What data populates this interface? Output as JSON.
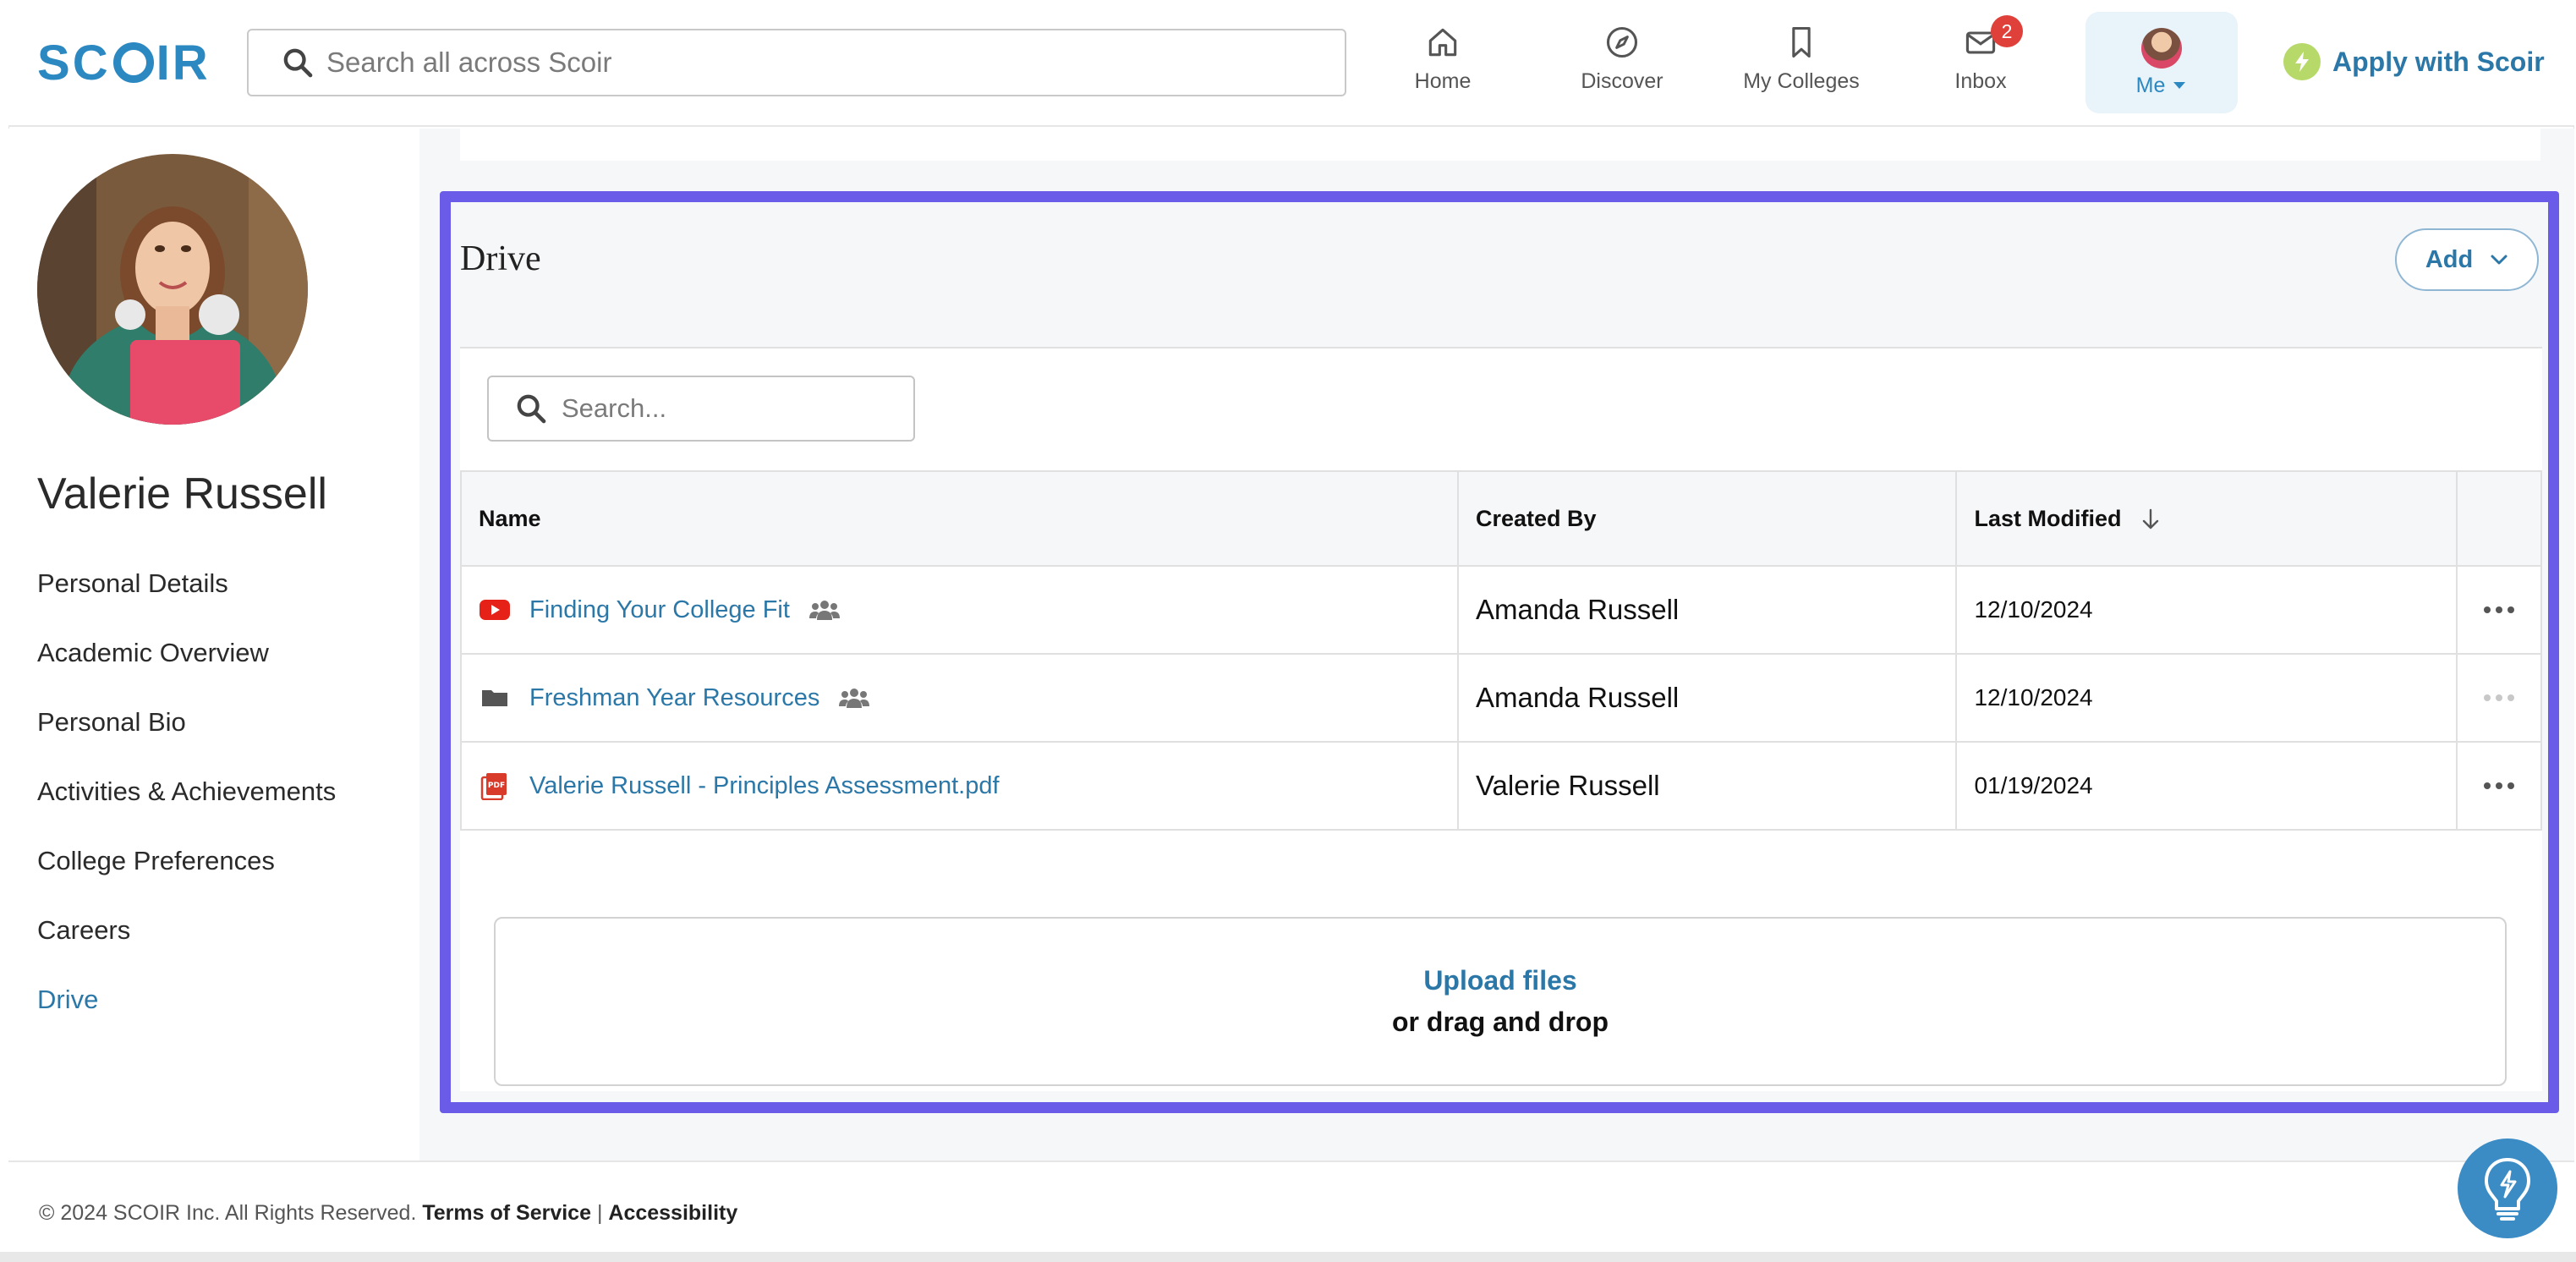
{
  "header": {
    "logo": "SCOIR",
    "search_placeholder": "Search all across Scoir",
    "nav": [
      {
        "label": "Home",
        "icon": "home-icon"
      },
      {
        "label": "Discover",
        "icon": "compass-icon"
      },
      {
        "label": "My Colleges",
        "icon": "bookmark-icon"
      },
      {
        "label": "Inbox",
        "icon": "inbox-icon",
        "badge": "2"
      }
    ],
    "me_label": "Me",
    "apply_label": "Apply with Scoir"
  },
  "sidebar": {
    "name": "Valerie Russell",
    "links": [
      {
        "label": "Personal Details"
      },
      {
        "label": "Academic Overview"
      },
      {
        "label": "Personal Bio"
      },
      {
        "label": "Activities & Achievements"
      },
      {
        "label": "College Preferences"
      },
      {
        "label": "Careers"
      },
      {
        "label": "Drive",
        "active": true
      }
    ]
  },
  "drive": {
    "title": "Drive",
    "add_label": "Add",
    "search_placeholder": "Search...",
    "columns": {
      "name": "Name",
      "created_by": "Created By",
      "last_modified": "Last Modified"
    },
    "files": [
      {
        "name": "Finding Your College Fit",
        "type": "video",
        "shared": true,
        "created_by": "Amanda Russell",
        "last_modified": "12/10/2024"
      },
      {
        "name": "Freshman Year Resources",
        "type": "folder",
        "shared": true,
        "created_by": "Amanda Russell",
        "last_modified": "12/10/2024"
      },
      {
        "name": "Valerie Russell - Principles Assessment.pdf",
        "type": "pdf",
        "shared": false,
        "created_by": "Valerie Russell",
        "last_modified": "01/19/2024"
      }
    ],
    "upload_label": "Upload files",
    "drag_label": "or drag and drop"
  },
  "footer": {
    "copyright": "© 2024 SCOIR Inc. All Rights Reserved.",
    "terms": "Terms of Service",
    "separator": "|",
    "accessibility": "Accessibility"
  },
  "colors": {
    "brand": "#2b88c1",
    "link": "#2b78a8",
    "highlight_outline": "#6a5ce9",
    "badge": "#e0403a"
  }
}
